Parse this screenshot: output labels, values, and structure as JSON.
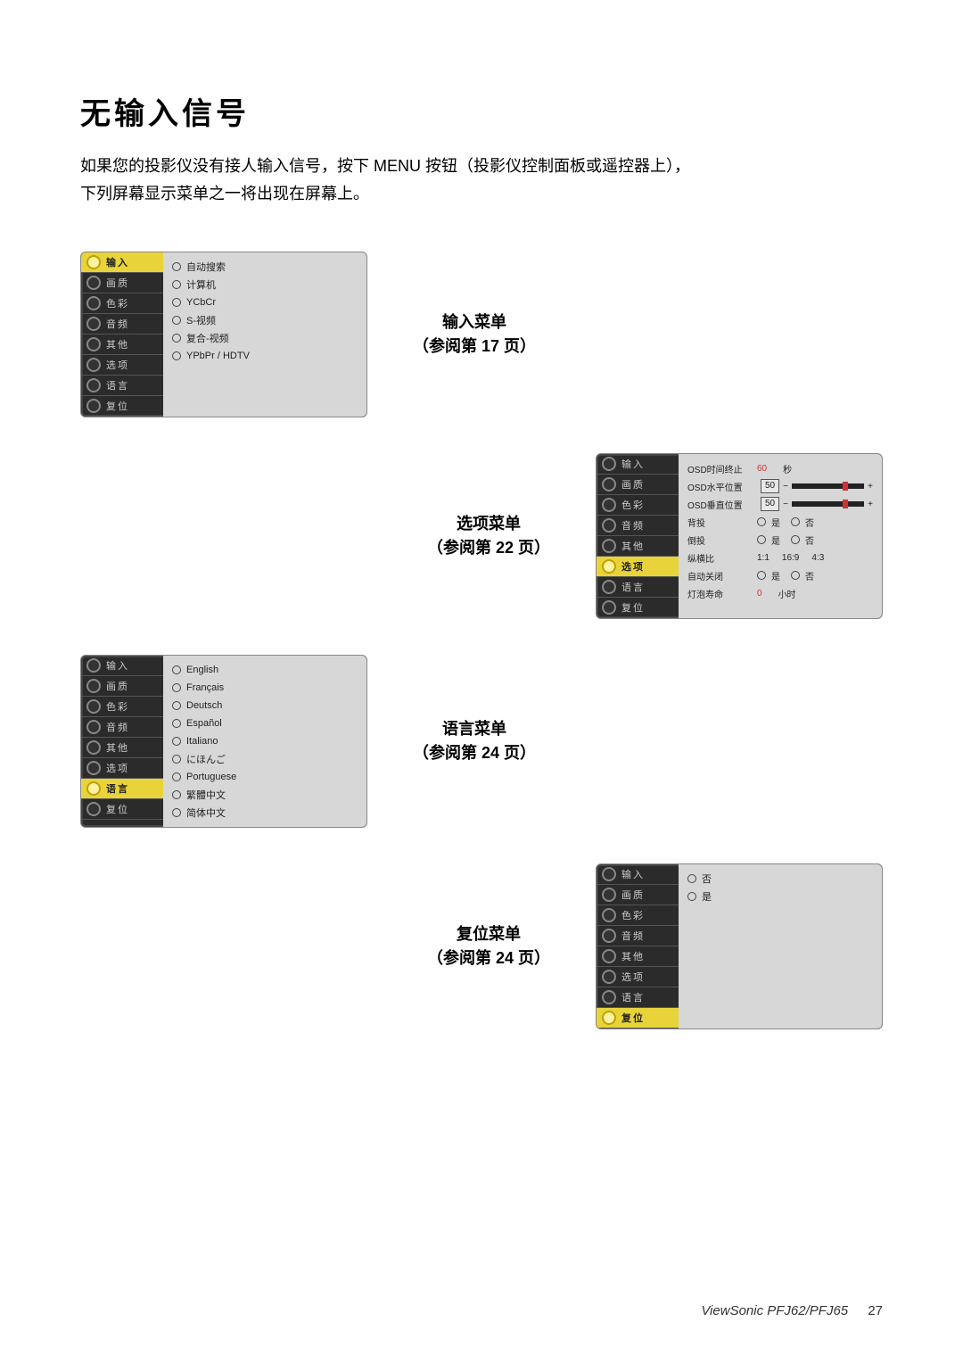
{
  "title": "无输入信号",
  "intro_line1": "如果您的投影仪没有接人输入信号，按下 MENU 按钮（投影仪控制面板或遥控器上），",
  "intro_line2": "下列屏幕显示菜单之一将出现在屏幕上。",
  "side_tabs": [
    "输入",
    "画质",
    "色彩",
    "音频",
    "其他",
    "选项",
    "语言",
    "复位"
  ],
  "input_menu": {
    "caption_title": "输入菜单",
    "caption_ref": "（参阅第  17  页）",
    "items": [
      "自动搜索",
      "计算机",
      "YCbCr",
      "S-视频",
      "复合-视频",
      "YPbPr / HDTV"
    ]
  },
  "options_menu": {
    "caption_title": "选项菜单",
    "caption_ref": "（参阅第  22  页）",
    "rows": {
      "osd_timeout_label": "OSD时间终止",
      "osd_timeout_value": "60",
      "osd_timeout_unit": "秒",
      "osd_hpos_label": "OSD水平位置",
      "osd_hpos_value": "50",
      "osd_vpos_label": "OSD垂直位置",
      "osd_vpos_value": "50",
      "back_proj_label": "背投",
      "yes": "是",
      "no": "否",
      "ceiling_label": "倒投",
      "aspect_label": "纵横比",
      "aspect_o1": "1:1",
      "aspect_o2": "16:9",
      "aspect_o3": "4:3",
      "auto_off_label": "自动关闭",
      "lamp_label": "灯泡寿命",
      "lamp_value": "0",
      "lamp_unit": "小时"
    }
  },
  "language_menu": {
    "caption_title": "语言菜单",
    "caption_ref": "（参阅第  24  页）",
    "items": [
      "English",
      "Français",
      "Deutsch",
      "Español",
      "Italiano",
      "にほんご",
      "Portuguese",
      "繁體中文",
      "简体中文"
    ]
  },
  "reset_menu": {
    "caption_title": "复位菜单",
    "caption_ref": "（参阅第  24  页）",
    "items": [
      "否",
      "是"
    ]
  },
  "footer_model": "ViewSonic  PFJ62/PFJ65",
  "footer_page": "27"
}
